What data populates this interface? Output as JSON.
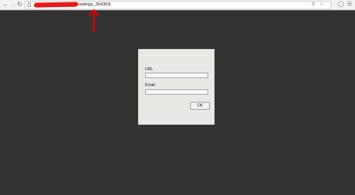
{
  "browser": {
    "url_suffix": "settings_364353l",
    "icons": {
      "back": "back-arrow-icon",
      "forward": "forward-arrow-icon",
      "reload": "reload-icon",
      "key": "key-icon",
      "star": "star-icon",
      "help": "help-icon",
      "menu": "menu-icon"
    }
  },
  "annotation": {
    "arrow_color": "#e00000",
    "redaction_color": "#e41b1b"
  },
  "dialog": {
    "url_label": "URL",
    "url_value": "",
    "email_label": "Email",
    "email_value": "",
    "ok_label": "OK"
  }
}
